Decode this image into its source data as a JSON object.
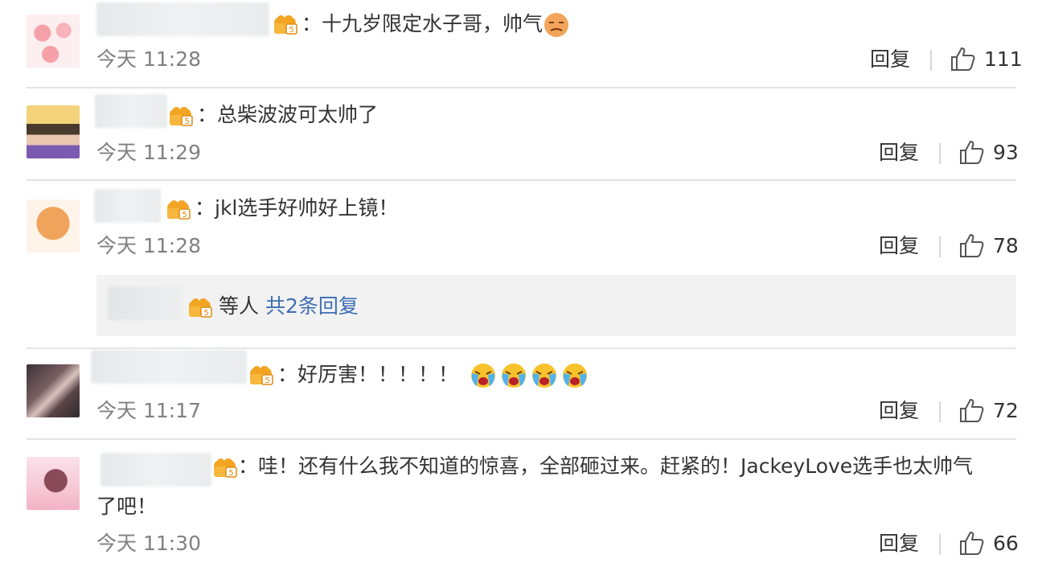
{
  "comments": [
    {
      "text": "：十九岁限定水子哥，帅气",
      "time": "今天 11:28",
      "reply": "回复",
      "likes": "111"
    },
    {
      "text": "：总柴波波可太帅了",
      "time": "今天 11:29",
      "reply": "回复",
      "likes": "93"
    },
    {
      "text": "：jkl选手好帅好上镜！",
      "time": "今天 11:28",
      "reply": "回复",
      "likes": "78"
    },
    {
      "text": "：好厉害！！！！！",
      "time": "今天 11:17",
      "reply": "回复",
      "likes": "72"
    },
    {
      "text_line1": "：哇！还有什么我不知道的惊喜，全部砸过来。赶紧的！JackeyLove选手也太帅气",
      "text_line2": "了吧！",
      "time": "今天 11:30",
      "reply": "回复",
      "likes": "66"
    }
  ],
  "subreply": {
    "suffix": "等人",
    "link": "共2条回复"
  },
  "colors": {
    "link": "#3e6fb5",
    "time": "#808080",
    "text": "#333333",
    "badge": "#f0a020"
  },
  "icons": [
    "badge-icon",
    "thumbs-up-icon",
    "face-emoji-icon",
    "crying-laugh-emoji-icon"
  ]
}
